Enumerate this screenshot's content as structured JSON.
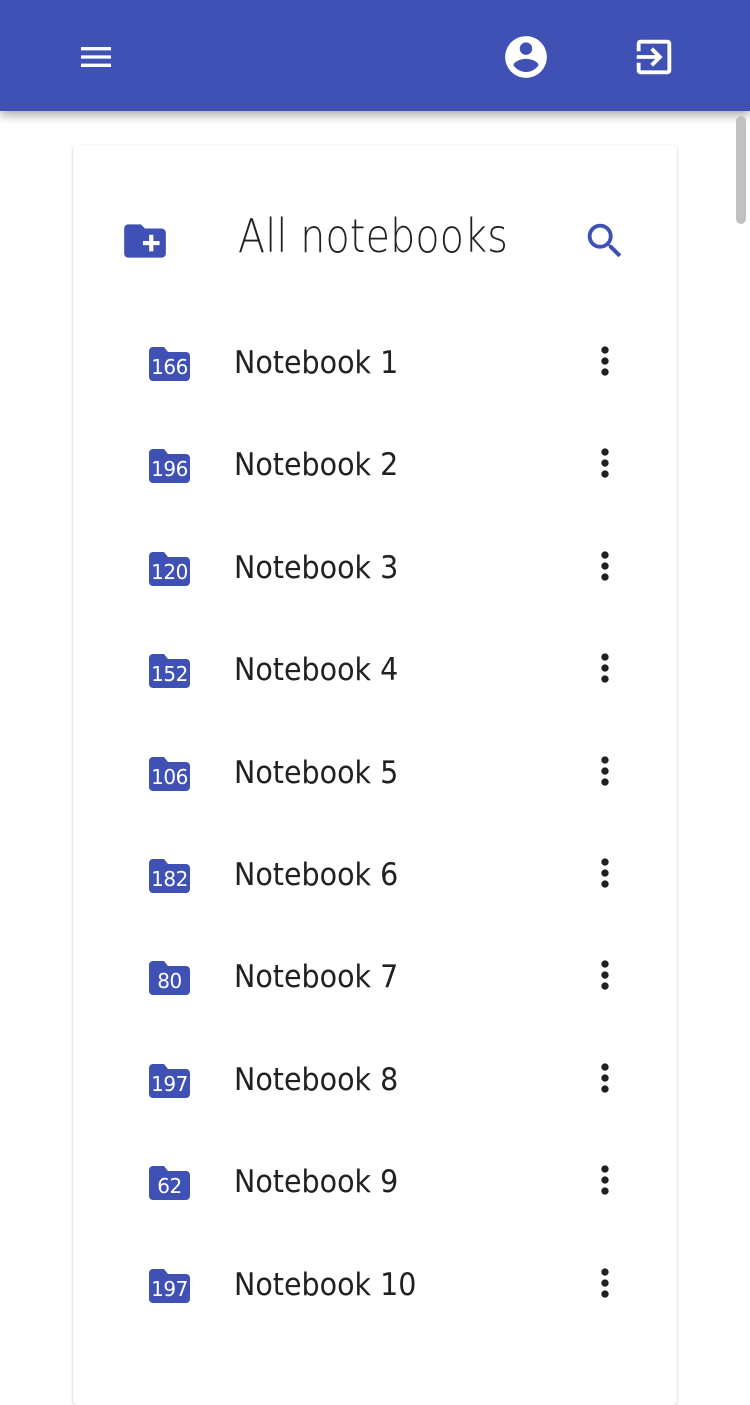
{
  "appbar": {
    "color": "#3f51b5",
    "menu_icon": "menu-icon",
    "account_icon": "account-circle-icon",
    "logout_icon": "exit-to-app-icon"
  },
  "card": {
    "title": "All notebooks",
    "add_icon": "create-new-folder-icon",
    "search_icon": "search-icon",
    "accent": "#3f51b5"
  },
  "notebooks": [
    {
      "name": "Notebook 1",
      "count": "166"
    },
    {
      "name": "Notebook 2",
      "count": "196"
    },
    {
      "name": "Notebook 3",
      "count": "120"
    },
    {
      "name": "Notebook 4",
      "count": "152"
    },
    {
      "name": "Notebook 5",
      "count": "106"
    },
    {
      "name": "Notebook 6",
      "count": "182"
    },
    {
      "name": "Notebook 7",
      "count": "80"
    },
    {
      "name": "Notebook 8",
      "count": "197"
    },
    {
      "name": "Notebook 9",
      "count": "62"
    },
    {
      "name": "Notebook 10",
      "count": "197"
    }
  ]
}
